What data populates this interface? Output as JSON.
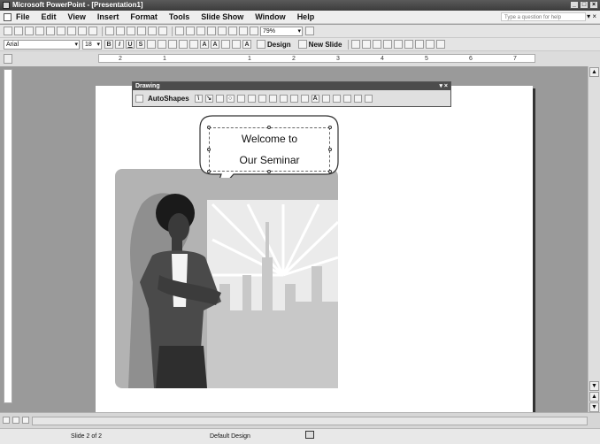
{
  "title_bar": {
    "title": "Microsoft PowerPoint - [Presentation1]"
  },
  "menu": {
    "items": [
      "File",
      "Edit",
      "View",
      "Insert",
      "Format",
      "Tools",
      "Slide Show",
      "Window",
      "Help"
    ],
    "help_placeholder": "Type a question for help"
  },
  "formatting": {
    "font": "Arial",
    "size": "18",
    "zoom": "79%",
    "design_label": "Design",
    "new_slide_label": "New Slide"
  },
  "drawing_toolbar": {
    "title": "Drawing",
    "autoshapes_label": "AutoShapes"
  },
  "ruler": {
    "labels": [
      "2",
      "1",
      "1",
      "2",
      "3",
      "4",
      "5",
      "6",
      "7"
    ]
  },
  "slide": {
    "callout_line1": "Welcome to",
    "callout_line2": "Our Seminar"
  },
  "status": {
    "slide_indicator": "Slide 2 of 2",
    "design_name": "Default Design"
  },
  "icons": [
    "save-icon",
    "open-icon",
    "print-icon",
    "bold-icon",
    "italic-icon",
    "underline-icon",
    "shadow-icon",
    "align-left-icon",
    "center-icon",
    "align-right-icon",
    "bullets-icon",
    "numbering-icon",
    "font-color-icon",
    "line-icon",
    "arrow-icon",
    "rectangle-icon",
    "oval-icon",
    "textbox-icon",
    "close-icon",
    "minimize-icon",
    "maximize-icon"
  ]
}
